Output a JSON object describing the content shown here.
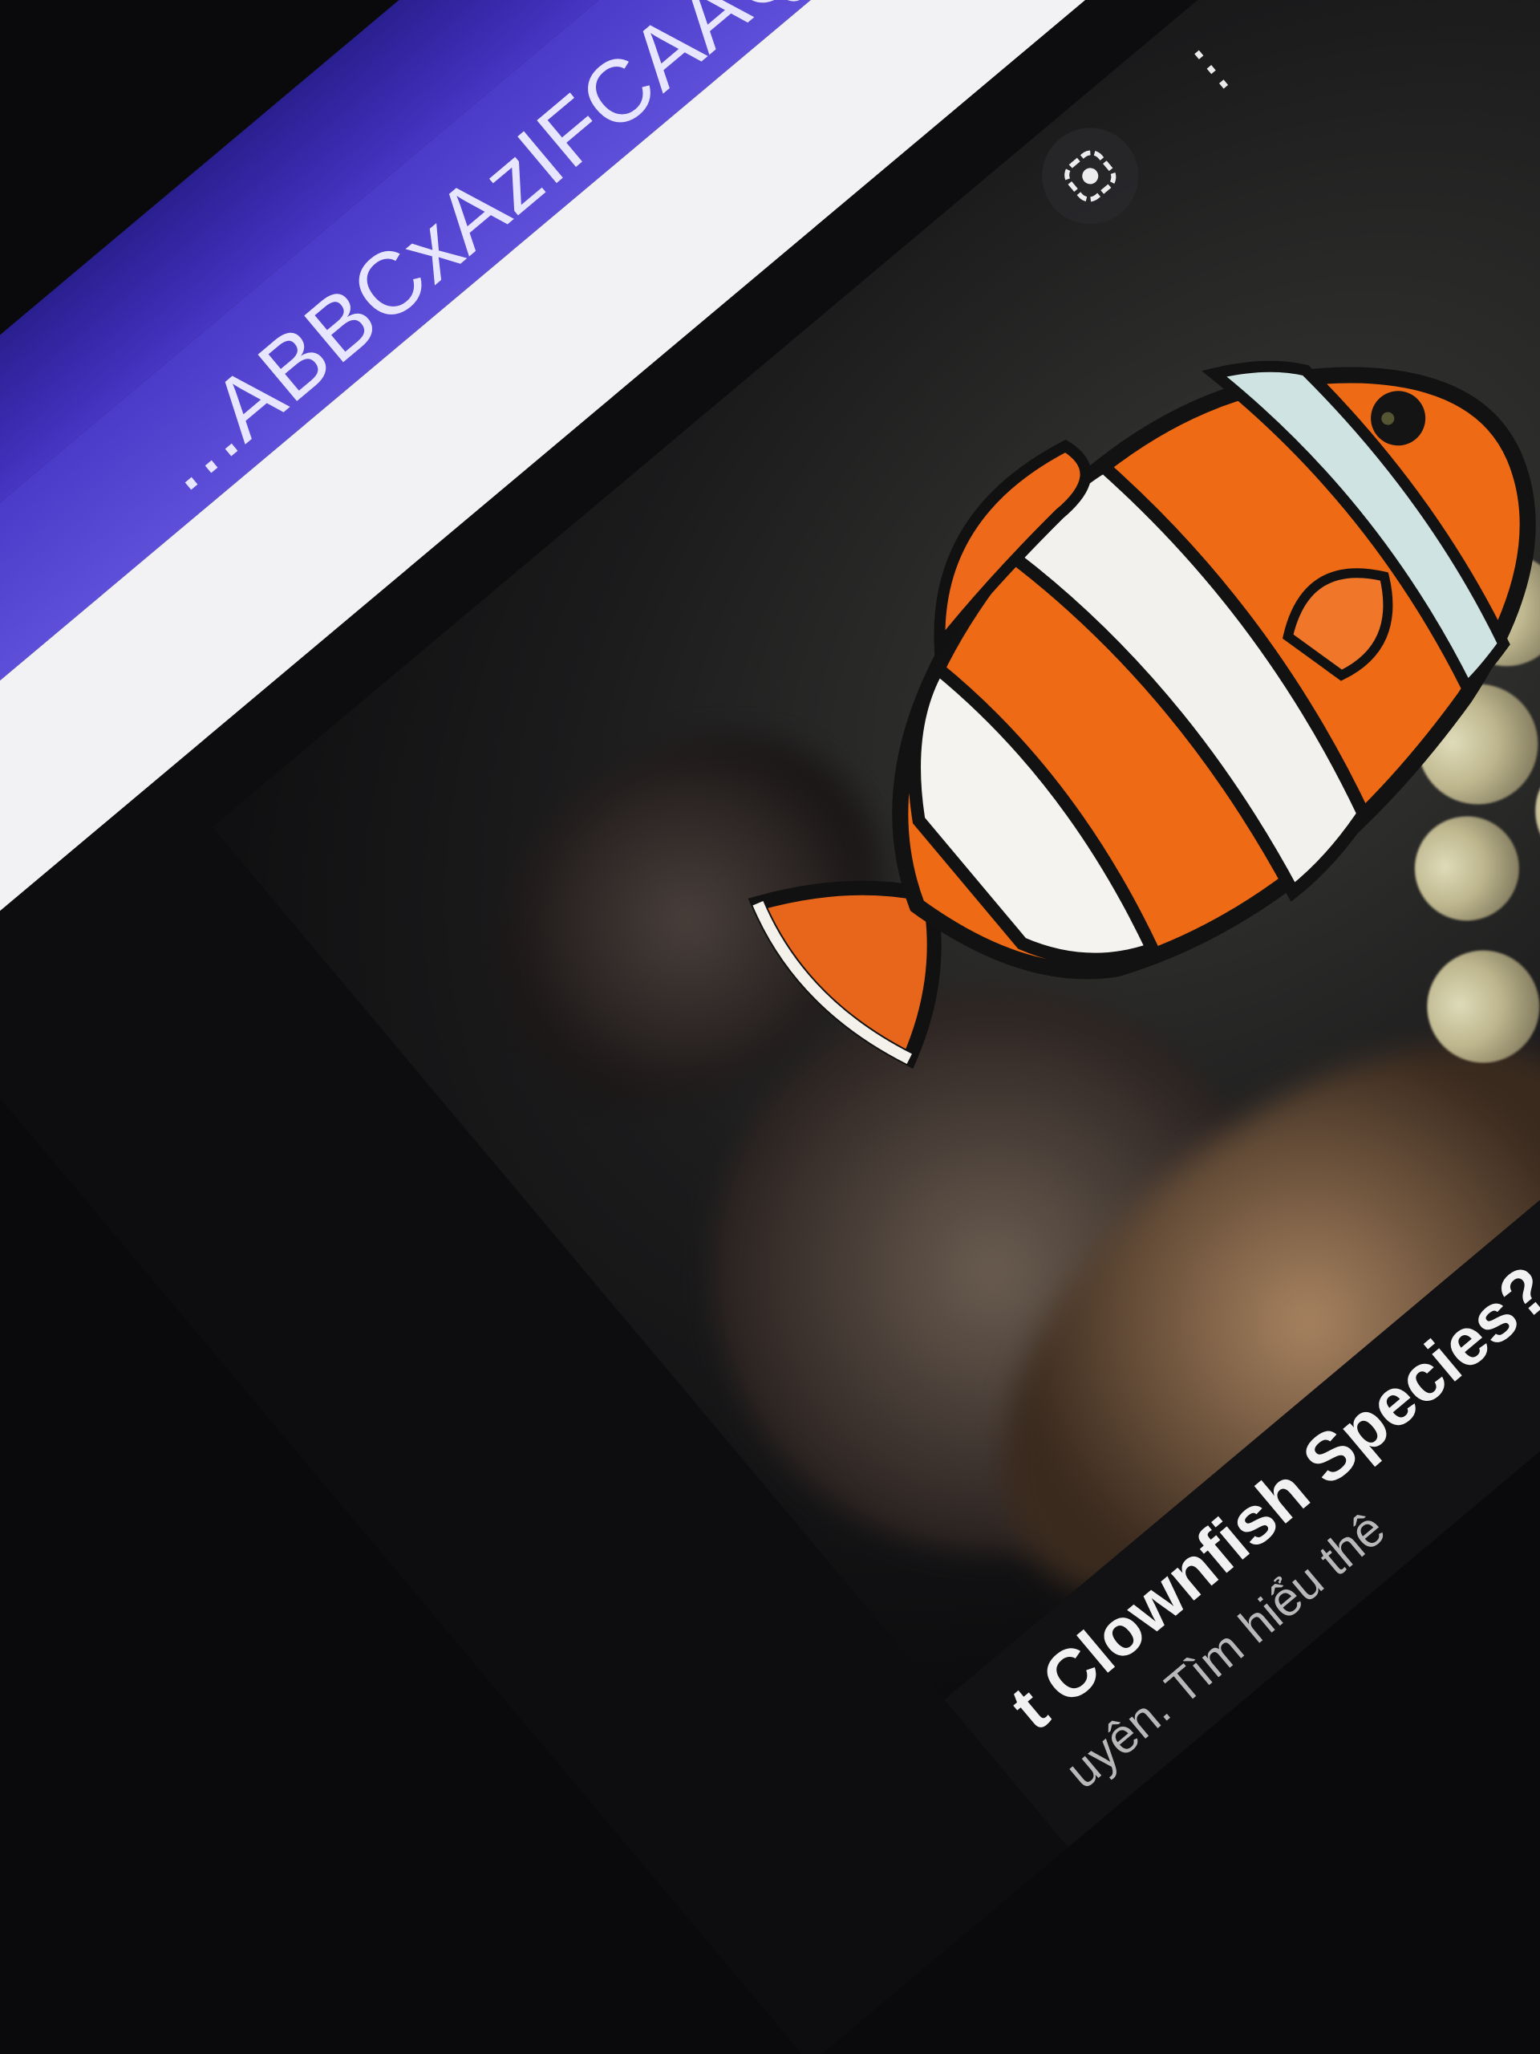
{
  "browser": {
    "url_fragment": "...ABBCxAzIFCAAQ...",
    "accent_color": "#4a3cc9"
  },
  "viewer": {
    "controls": {
      "collapse_icon": "chevron-collapse-icon",
      "expand_icon": "chevron-expand-icon",
      "more_icon": "more-options-icon",
      "lens_icon": "google-lens-icon"
    },
    "image_subject": "clownfish"
  },
  "caption": {
    "title": "t Clownfish Species? (",
    "subtitle": "uyên. Tìm hiểu thê"
  }
}
